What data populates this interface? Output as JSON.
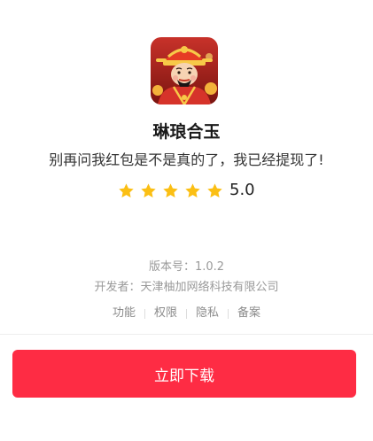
{
  "app": {
    "name": "琳琅合玉",
    "tagline": "别再问我红包是不是真的了，我已经提现了!",
    "rating_value": "5.0",
    "rating_stars": 5,
    "icon": "god-of-wealth-app-icon"
  },
  "info": {
    "version": "版本号：1.0.2",
    "developer": "开发者：天津柚加网络科技有限公司"
  },
  "links": {
    "features": "功能",
    "permissions": "权限",
    "privacy": "隐私",
    "filing": "备案"
  },
  "actions": {
    "download_label": "立即下载"
  },
  "colors": {
    "accent": "#fe2c44",
    "star": "#fbbf14",
    "muted_text": "#9a9a9a"
  }
}
